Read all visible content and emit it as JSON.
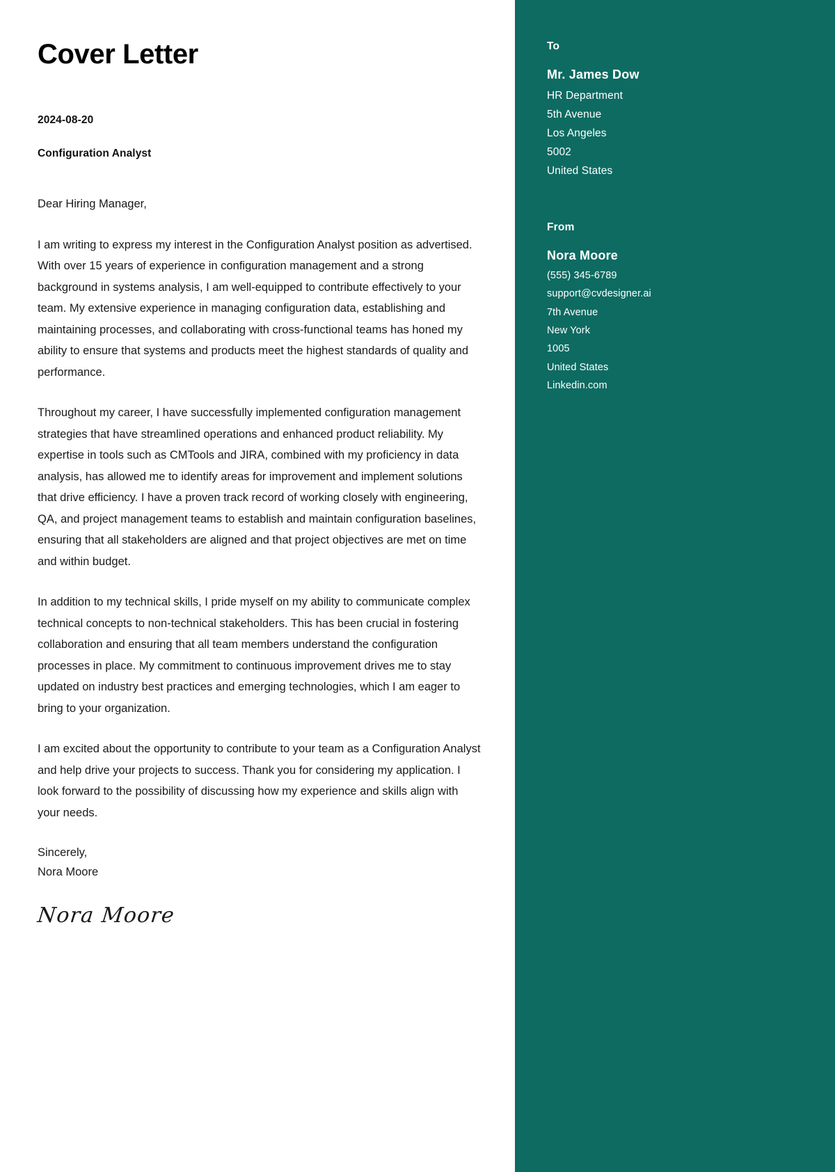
{
  "document": {
    "title": "Cover Letter",
    "date": "2024-08-20",
    "position": "Configuration Analyst",
    "salutation": "Dear Hiring Manager,",
    "paragraphs": [
      "I am writing to express my interest in the Configuration Analyst position as advertised. With over 15 years of experience in configuration management and a strong background in systems analysis, I am well-equipped to contribute effectively to your team. My extensive experience in managing configuration data, establishing and maintaining processes, and collaborating with cross-functional teams has honed my ability to ensure that systems and products meet the highest standards of quality and performance.",
      "Throughout my career, I have successfully implemented configuration management strategies that have streamlined operations and enhanced product reliability. My expertise in tools such as CMTools and JIRA, combined with my proficiency in data analysis, has allowed me to identify areas for improvement and implement solutions that drive efficiency. I have a proven track record of working closely with engineering, QA, and project management teams to establish and maintain configuration baselines, ensuring that all stakeholders are aligned and that project objectives are met on time and within budget.",
      "In addition to my technical skills, I pride myself on my ability to communicate complex technical concepts to non-technical stakeholders. This has been crucial in fostering collaboration and ensuring that all team members understand the configuration processes in place. My commitment to continuous improvement drives me to stay updated on industry best practices and emerging technologies, which I am eager to bring to your organization.",
      "I am excited about the opportunity to contribute to your team as a Configuration Analyst and help drive your projects to success. Thank you for considering my application. I look forward to the possibility of discussing how my experience and skills align with your needs."
    ],
    "closing": "Sincerely,",
    "closing_name": "Nora Moore",
    "signature": "Nora Moore"
  },
  "sidebar": {
    "to": {
      "heading": "To",
      "name": "Mr. James Dow",
      "lines": [
        "HR Department",
        "5th Avenue",
        "Los Angeles",
        "5002",
        "United States"
      ]
    },
    "from": {
      "heading": "From",
      "name": "Nora Moore",
      "lines": [
        "(555) 345-6789",
        "support@cvdesigner.ai",
        "7th Avenue",
        "New York",
        "1005",
        "United States",
        "Linkedin.com"
      ]
    }
  },
  "colors": {
    "sidebar_background": "#0d6b62",
    "page_background": "#ffffff",
    "body_text": "#1a1a1a",
    "sidebar_text": "#ffffff"
  }
}
